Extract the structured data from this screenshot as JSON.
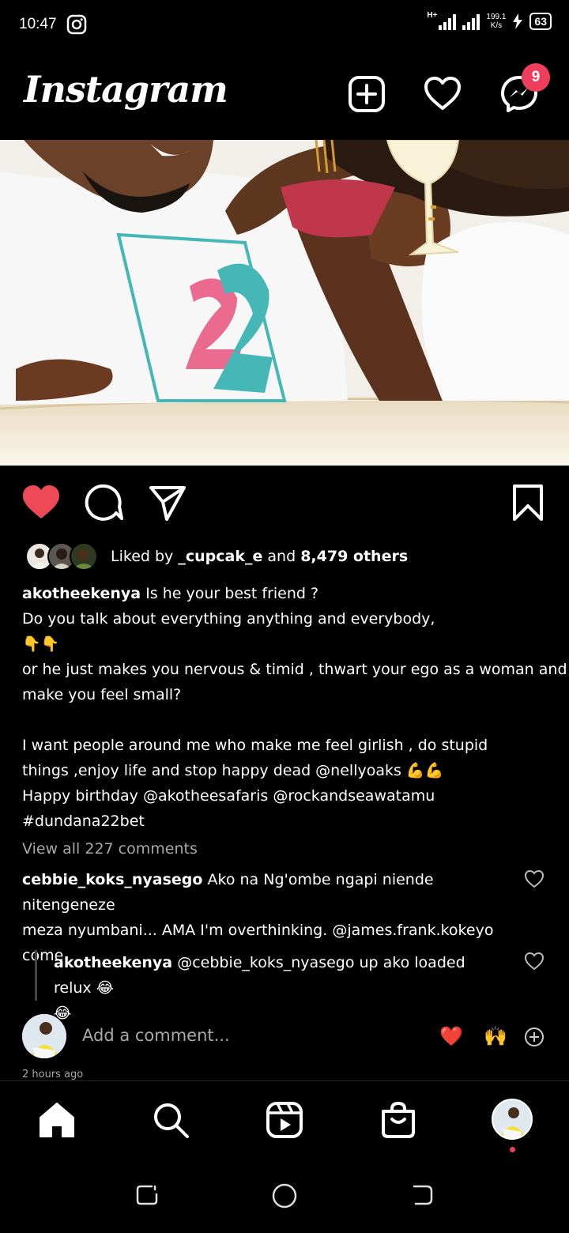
{
  "status_bar": {
    "time": "10:47",
    "network_type": "H+",
    "net_speed_value": "199.1",
    "net_speed_unit": "K/s",
    "battery": "63"
  },
  "header": {
    "app_name": "Instagram",
    "notification_count": "9"
  },
  "post": {
    "liked_by_prefix": "Liked by",
    "liked_by_user": "_cupcak_e",
    "liked_by_and": "and",
    "liked_by_others": "8,479 others",
    "caption_user": "akotheekenya",
    "caption_lines": [
      "Is he your best friend ?",
      "Do you talk about everything anything and everybody,",
      "👇👇",
      "or he just makes you nervous & timid , thwart your ego as a woman and",
      "make you feel small?",
      "",
      "I want people around me who make me feel girlish , do stupid",
      "things ,enjoy life and stop happy dead @nellyoaks 💪💪",
      "Happy birthday @akotheesafaris @rockandseawatamu",
      "#dundana22bet"
    ],
    "view_all_comments": "View all 227 comments",
    "comments": [
      {
        "user": "cebbie_koks_nyasego",
        "lines": [
          "Ako  na Ng'ombe ngapi niende nitengeneze",
          "meza nyumbani... AMA I'm overthinking.  @james.frank.kokeyo",
          "come"
        ]
      },
      {
        "user": "akotheekenya",
        "lines": [
          "@cebbie_koks_nyasego up ako loaded relux 😂",
          "😂"
        ]
      }
    ],
    "add_comment_placeholder": "Add a comment...",
    "quick_emojis": [
      "❤️",
      "🙌"
    ],
    "time_ago": "2 hours ago"
  },
  "colors": {
    "like_red": "#ed4956",
    "badge": "#ef3e5c",
    "muted": "#a8a8a8"
  }
}
